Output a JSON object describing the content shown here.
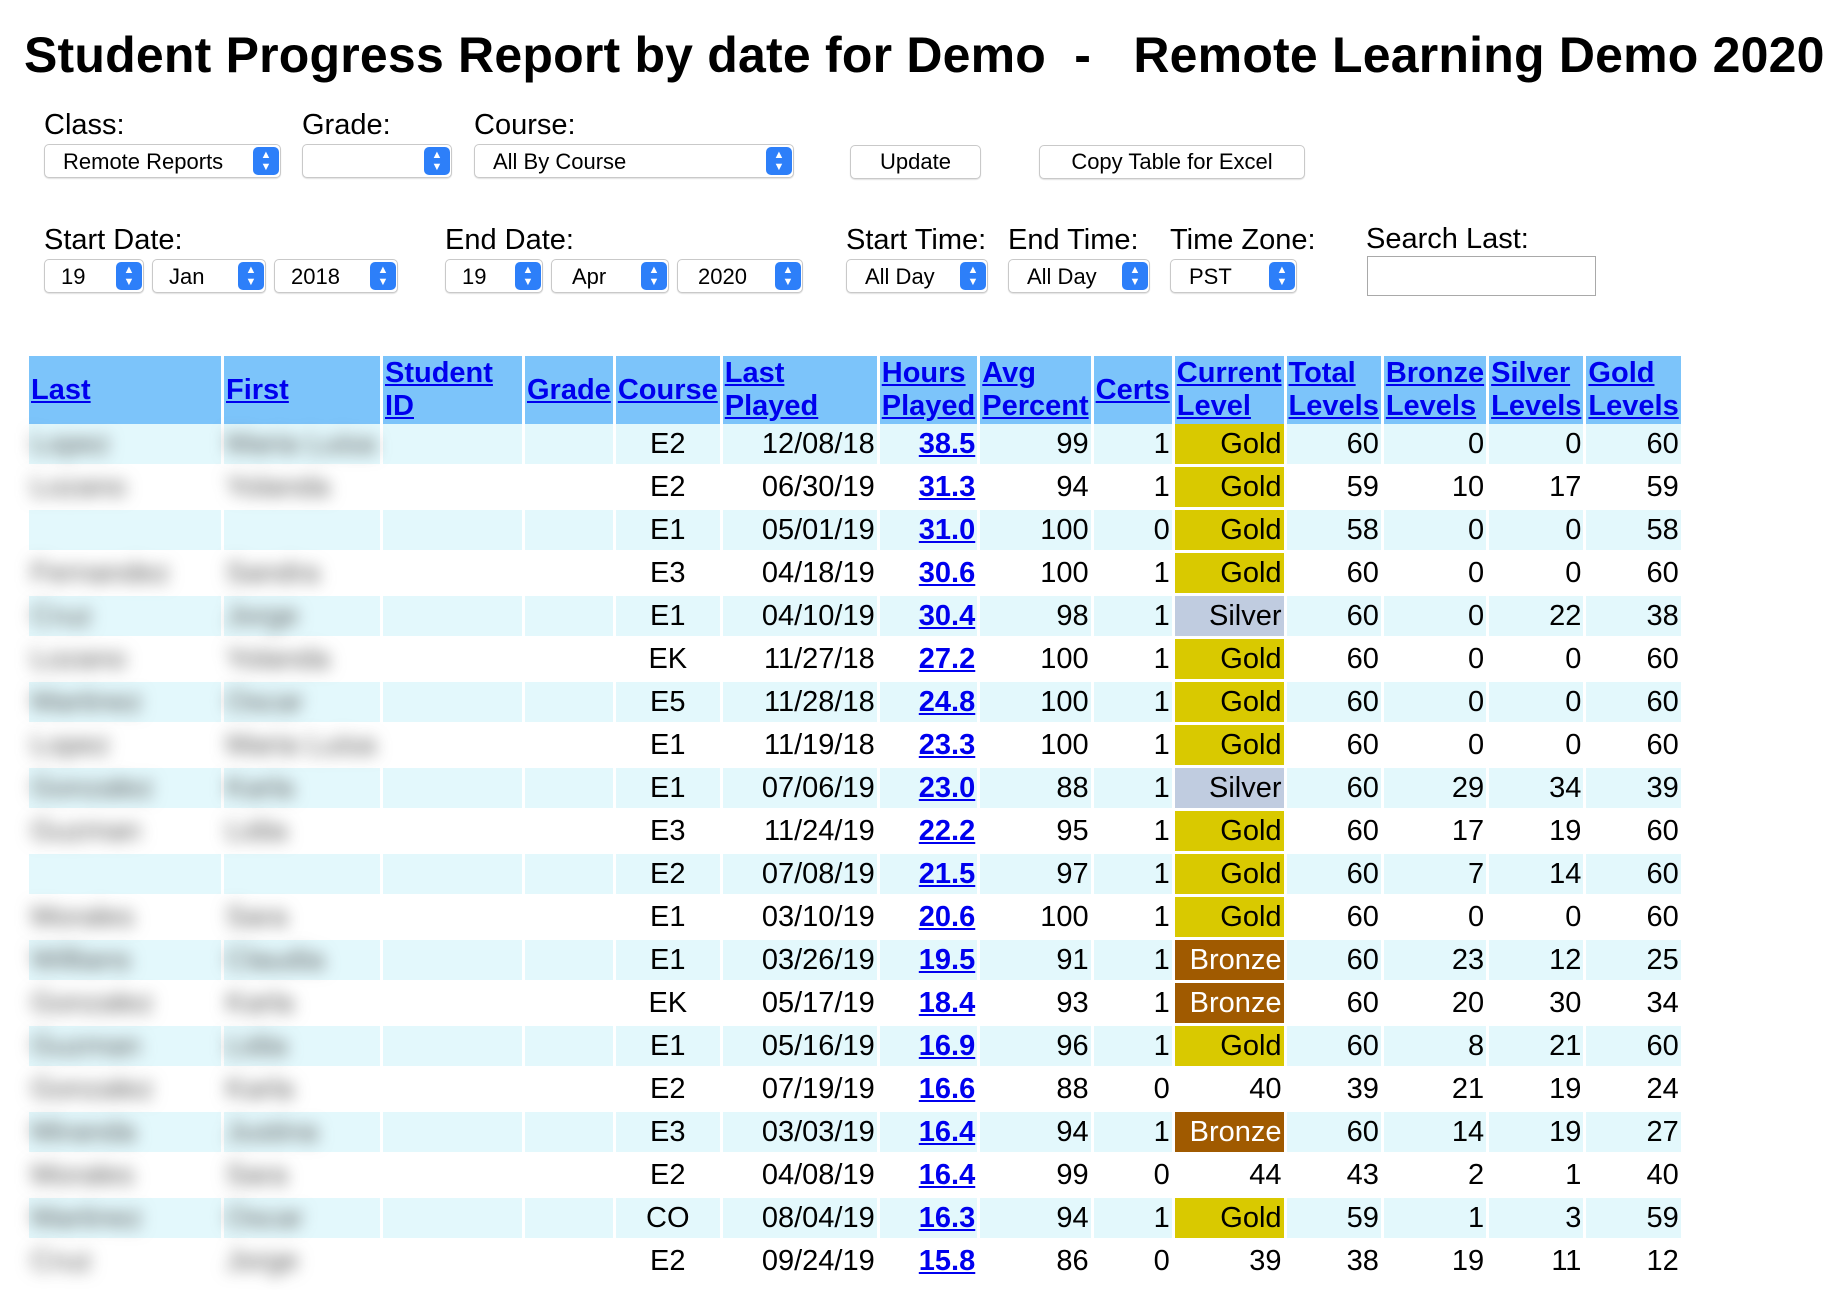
{
  "title": "Student Progress Report by date for Demo  -   Remote Learning Demo 2020",
  "filters": {
    "class_label": "Class:",
    "class_value": "Remote Reports",
    "grade_label": "Grade:",
    "grade_value": "",
    "course_label": "Course:",
    "course_value": "All By Course",
    "update_label": "Update",
    "copy_label": "Copy Table for Excel",
    "start_date_label": "Start Date:",
    "start_day": "19",
    "start_month": "Jan",
    "start_year": "2018",
    "end_date_label": "End Date:",
    "end_day": "19",
    "end_month": "Apr",
    "end_year": "2020",
    "start_time_label": "Start Time:",
    "start_time": "All Day",
    "end_time_label": "End Time:",
    "end_time": "All Day",
    "tz_label": "Time Zone:",
    "tz": "PST",
    "search_label": "Search Last:",
    "search_value": ""
  },
  "table": {
    "headers": {
      "last": "Last",
      "first": "First",
      "student_id": "Student ID",
      "grade": "Grade",
      "course": "Course",
      "last_played": "Last Played",
      "hours1": "Hours",
      "hours2": "Played",
      "avg1": "Avg",
      "avg2": "Percent",
      "certs": "Certs",
      "cur1": "Current",
      "cur2": "Level",
      "tot1": "Total",
      "tot2": "Levels",
      "br1": "Bronze",
      "br2": "Levels",
      "si1": "Silver",
      "si2": "Levels",
      "go1": "Gold",
      "go2": "Levels"
    },
    "rows": [
      {
        "last": "Lopez",
        "first": "Maria Luisa",
        "course": "E2",
        "last_played": "12/08/18",
        "hours": "38.5",
        "avg": "99",
        "certs": "1",
        "level": "Gold",
        "total": "60",
        "bronze": "0",
        "silver": "0",
        "gold": "60"
      },
      {
        "last": "Lozano",
        "first": "Yolanda",
        "course": "E2",
        "last_played": "06/30/19",
        "hours": "31.3",
        "avg": "94",
        "certs": "1",
        "level": "Gold",
        "total": "59",
        "bronze": "10",
        "silver": "17",
        "gold": "59"
      },
      {
        "last": "",
        "first": "",
        "course": "E1",
        "last_played": "05/01/19",
        "hours": "31.0",
        "avg": "100",
        "certs": "0",
        "level": "Gold",
        "total": "58",
        "bronze": "0",
        "silver": "0",
        "gold": "58"
      },
      {
        "last": "Fernandez",
        "first": "Sandra",
        "course": "E3",
        "last_played": "04/18/19",
        "hours": "30.6",
        "avg": "100",
        "certs": "1",
        "level": "Gold",
        "total": "60",
        "bronze": "0",
        "silver": "0",
        "gold": "60"
      },
      {
        "last": "Cruz",
        "first": "Jorge",
        "course": "E1",
        "last_played": "04/10/19",
        "hours": "30.4",
        "avg": "98",
        "certs": "1",
        "level": "Silver",
        "total": "60",
        "bronze": "0",
        "silver": "22",
        "gold": "38"
      },
      {
        "last": "Lozano",
        "first": "Yolanda",
        "course": "EK",
        "last_played": "11/27/18",
        "hours": "27.2",
        "avg": "100",
        "certs": "1",
        "level": "Gold",
        "total": "60",
        "bronze": "0",
        "silver": "0",
        "gold": "60"
      },
      {
        "last": "Martinez",
        "first": "Oscar",
        "course": "E5",
        "last_played": "11/28/18",
        "hours": "24.8",
        "avg": "100",
        "certs": "1",
        "level": "Gold",
        "total": "60",
        "bronze": "0",
        "silver": "0",
        "gold": "60"
      },
      {
        "last": "Lopez",
        "first": "Maria Luisa",
        "course": "E1",
        "last_played": "11/19/18",
        "hours": "23.3",
        "avg": "100",
        "certs": "1",
        "level": "Gold",
        "total": "60",
        "bronze": "0",
        "silver": "0",
        "gold": "60"
      },
      {
        "last": "Gonzalez",
        "first": "Karla",
        "course": "E1",
        "last_played": "07/06/19",
        "hours": "23.0",
        "avg": "88",
        "certs": "1",
        "level": "Silver",
        "total": "60",
        "bronze": "29",
        "silver": "34",
        "gold": "39"
      },
      {
        "last": "Guzman",
        "first": "Lidia",
        "course": "E3",
        "last_played": "11/24/19",
        "hours": "22.2",
        "avg": "95",
        "certs": "1",
        "level": "Gold",
        "total": "60",
        "bronze": "17",
        "silver": "19",
        "gold": "60"
      },
      {
        "last": "",
        "first": "",
        "course": "E2",
        "last_played": "07/08/19",
        "hours": "21.5",
        "avg": "97",
        "certs": "1",
        "level": "Gold",
        "total": "60",
        "bronze": "7",
        "silver": "14",
        "gold": "60"
      },
      {
        "last": "Morales",
        "first": "Sara",
        "course": "E1",
        "last_played": "03/10/19",
        "hours": "20.6",
        "avg": "100",
        "certs": "1",
        "level": "Gold",
        "total": "60",
        "bronze": "0",
        "silver": "0",
        "gold": "60"
      },
      {
        "last": "Willians",
        "first": "Claudia",
        "course": "E1",
        "last_played": "03/26/19",
        "hours": "19.5",
        "avg": "91",
        "certs": "1",
        "level": "Bronze",
        "total": "60",
        "bronze": "23",
        "silver": "12",
        "gold": "25"
      },
      {
        "last": "Gonzalez",
        "first": "Karla",
        "course": "EK",
        "last_played": "05/17/19",
        "hours": "18.4",
        "avg": "93",
        "certs": "1",
        "level": "Bronze",
        "total": "60",
        "bronze": "20",
        "silver": "30",
        "gold": "34"
      },
      {
        "last": "Guzman",
        "first": "Lidia",
        "course": "E1",
        "last_played": "05/16/19",
        "hours": "16.9",
        "avg": "96",
        "certs": "1",
        "level": "Gold",
        "total": "60",
        "bronze": "8",
        "silver": "21",
        "gold": "60"
      },
      {
        "last": "Gonzalez",
        "first": "Karla",
        "course": "E2",
        "last_played": "07/19/19",
        "hours": "16.6",
        "avg": "88",
        "certs": "0",
        "level": "40",
        "total": "39",
        "bronze": "21",
        "silver": "19",
        "gold": "24"
      },
      {
        "last": "Miranda",
        "first": "Justina",
        "course": "E3",
        "last_played": "03/03/19",
        "hours": "16.4",
        "avg": "94",
        "certs": "1",
        "level": "Bronze",
        "total": "60",
        "bronze": "14",
        "silver": "19",
        "gold": "27"
      },
      {
        "last": "Morales",
        "first": "Sara",
        "course": "E2",
        "last_played": "04/08/19",
        "hours": "16.4",
        "avg": "99",
        "certs": "0",
        "level": "44",
        "total": "43",
        "bronze": "2",
        "silver": "1",
        "gold": "40"
      },
      {
        "last": "Martinez",
        "first": "Oscar",
        "course": "CO",
        "last_played": "08/04/19",
        "hours": "16.3",
        "avg": "94",
        "certs": "1",
        "level": "Gold",
        "total": "59",
        "bronze": "1",
        "silver": "3",
        "gold": "59"
      },
      {
        "last": "Cruz",
        "first": "Jorge",
        "course": "E2",
        "last_played": "09/24/19",
        "hours": "15.8",
        "avg": "86",
        "certs": "0",
        "level": "39",
        "total": "38",
        "bronze": "19",
        "silver": "11",
        "gold": "12"
      }
    ]
  },
  "colors": {
    "header_bg": "#7cc4fa",
    "row_alt": "#e3f8fc",
    "gold": "#d9c900",
    "silver": "#c0cce0",
    "bronze": "#a05a00",
    "link": "#0000ee"
  }
}
